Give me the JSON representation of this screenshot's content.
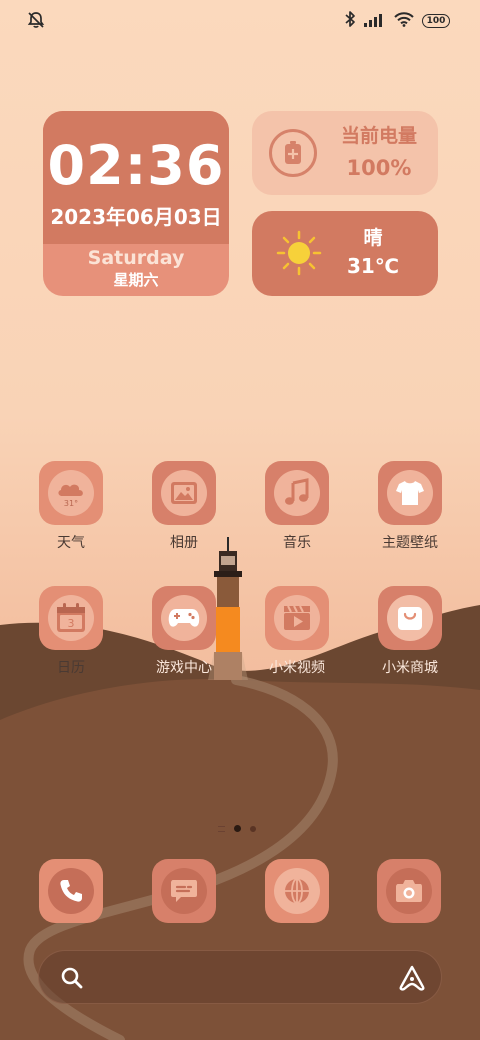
{
  "status_bar": {
    "left_icon": "bell-muted-icon",
    "right_icons": [
      "bluetooth-icon",
      "signal-icon",
      "wifi-icon"
    ],
    "battery_level": "100"
  },
  "clock_widget": {
    "time": "02:36",
    "date": "2023年06月03日",
    "weekday": "Saturday",
    "weekday_cn": "星期六"
  },
  "battery_widget": {
    "icon": "battery-charging-icon",
    "title": "当前电量",
    "value": "100%"
  },
  "weather_widget": {
    "icon": "sun-icon",
    "condition": "晴",
    "temperature": "31℃"
  },
  "apps": [
    {
      "label": "天气",
      "icon": "cloud-icon",
      "badge": "31°"
    },
    {
      "label": "相册",
      "icon": "gallery-icon"
    },
    {
      "label": "音乐",
      "icon": "music-note-icon"
    },
    {
      "label": "主题壁纸",
      "icon": "tshirt-icon"
    },
    {
      "label": "日历",
      "icon": "calendar-icon",
      "badge": "3"
    },
    {
      "label": "游戏中心",
      "icon": "gamepad-icon"
    },
    {
      "label": "小米视频",
      "icon": "video-clapper-icon"
    },
    {
      "label": "小米商城",
      "icon": "shopping-bag-icon"
    }
  ],
  "page_indicator": {
    "pages": 2,
    "active": 1
  },
  "dock": [
    {
      "name": "phone",
      "icon": "phone-icon"
    },
    {
      "name": "messages",
      "icon": "message-icon"
    },
    {
      "name": "browser",
      "icon": "browser-globe-icon"
    },
    {
      "name": "camera",
      "icon": "camera-icon"
    }
  ],
  "search_bar": {
    "search_icon": "search-icon",
    "assistant_icon": "assistant-icon"
  },
  "colors": {
    "accent": "#d27a61",
    "accent_light": "#e48f75",
    "widget_light": "#f4c3aa",
    "hill_dark": "#6b4731",
    "hill_mid": "#7d5138"
  }
}
